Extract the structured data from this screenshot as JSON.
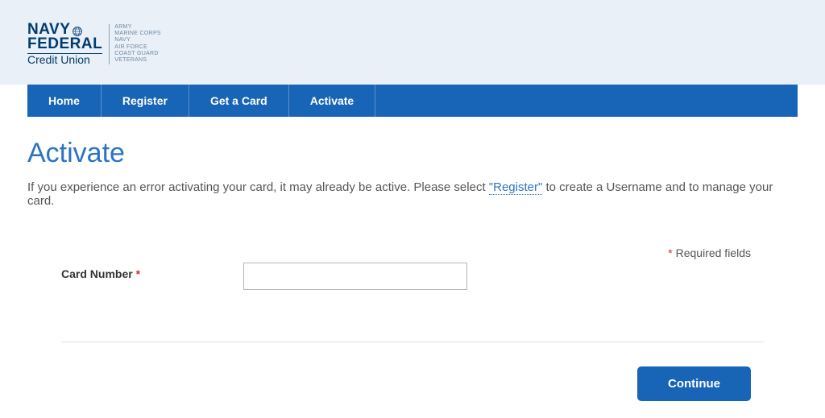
{
  "logo": {
    "line1": "NAVY",
    "line2": "FEDERAL",
    "sub": "Credit Union",
    "branches": [
      "ARMY",
      "MARINE CORPS",
      "NAVY",
      "AIR FORCE",
      "COAST GUARD",
      "VETERANS"
    ]
  },
  "nav": {
    "items": [
      {
        "label": "Home"
      },
      {
        "label": "Register"
      },
      {
        "label": "Get a Card"
      },
      {
        "label": "Activate"
      }
    ]
  },
  "page": {
    "title": "Activate",
    "instruction_pre": "If you experience an error activating your card, it may already be active. Please select ",
    "instruction_link": "\"Register\"",
    "instruction_post": " to create a Username and to manage your card.",
    "required_fields_label": " Required fields",
    "required_star": "*"
  },
  "form": {
    "card_number_label": "Card Number ",
    "card_number_star": "*",
    "card_number_value": "",
    "continue_label": "Continue"
  }
}
